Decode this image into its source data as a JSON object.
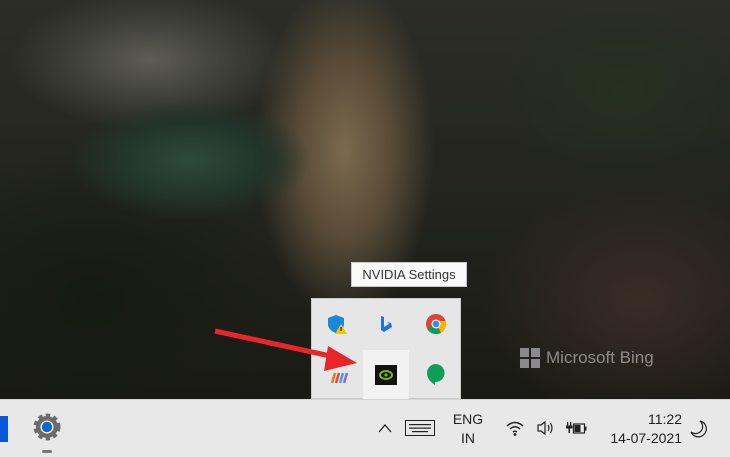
{
  "tooltip": "NVIDIA Settings",
  "watermark": "Microsoft Bing",
  "tray_icons": [
    "windows-security-warning-icon",
    "bing-icon",
    "chrome-icon",
    "colorful-app-icon",
    "nvidia-icon",
    "hangouts-icon"
  ],
  "taskbar": {
    "language_line1": "ENG",
    "language_line2": "IN",
    "time": "11:22",
    "date": "14-07-2021"
  },
  "colors": {
    "annotation_arrow": "#e8262a",
    "nvidia_green": "#76b900",
    "accent": "#0078d4"
  }
}
